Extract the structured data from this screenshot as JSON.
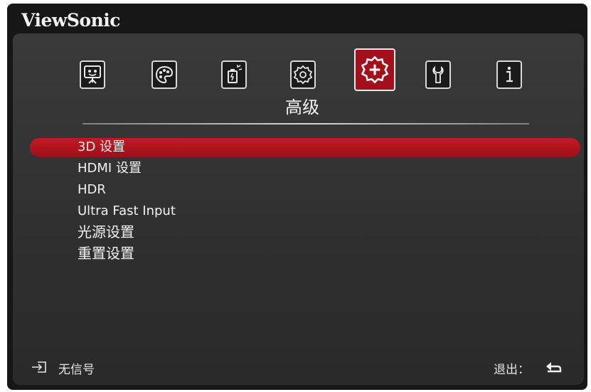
{
  "brand": "ViewSonic",
  "tabs": [
    {
      "icon": "display-icon"
    },
    {
      "icon": "color-palette-icon"
    },
    {
      "icon": "power-management-icon"
    },
    {
      "icon": "basic-settings-icon"
    },
    {
      "icon": "advanced-settings-icon",
      "active": true
    },
    {
      "icon": "system-icon"
    },
    {
      "icon": "information-icon"
    }
  ],
  "active_tab_label": "高级",
  "menu": {
    "items": [
      "3D 设置",
      "HDMI 设置",
      "HDR",
      "Ultra Fast Input",
      "光源设置",
      "重置设置"
    ],
    "selected_index": 0
  },
  "footer": {
    "source_status": "无信号",
    "exit_label": "退出："
  },
  "colors": {
    "accent": "#a3101b",
    "panel": "#333333",
    "frame": "#171717",
    "text": "#f2f2f2"
  }
}
